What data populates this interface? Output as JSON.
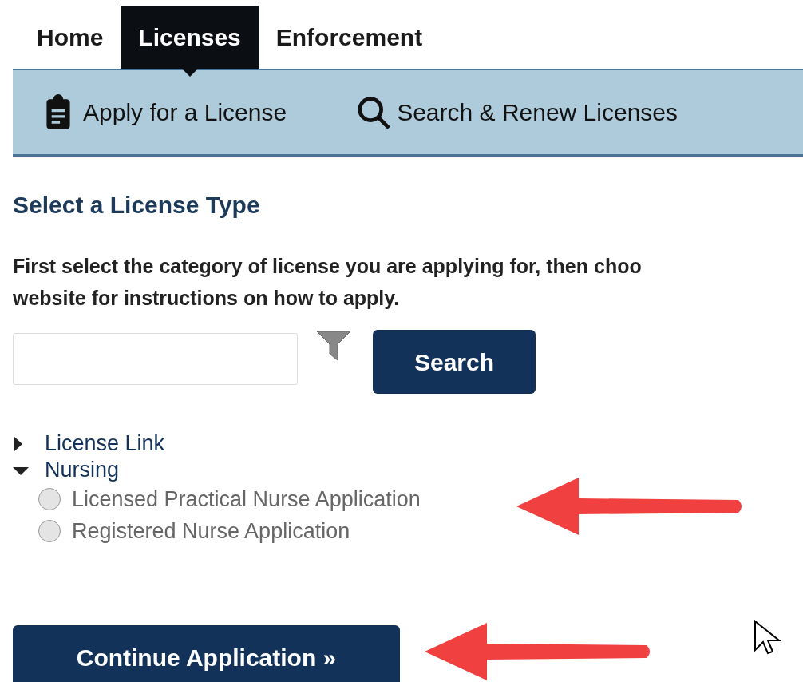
{
  "tabs": [
    {
      "label": "Home",
      "selected": false
    },
    {
      "label": "Licenses",
      "selected": true
    },
    {
      "label": "Enforcement",
      "selected": false
    }
  ],
  "subnav": [
    {
      "label": "Apply for a License",
      "kind": "clipboard"
    },
    {
      "label": "Search & Renew Licenses",
      "kind": "search"
    }
  ],
  "heading": "Select a License Type",
  "instructions": [
    "First select the category of license you are applying for, then choo",
    "website for instructions on how to apply."
  ],
  "search": {
    "button": "Search"
  },
  "tree": [
    {
      "label": "License Link",
      "expanded": false
    },
    {
      "label": "Nursing",
      "expanded": true,
      "children": [
        {
          "label": "Licensed Practical Nurse Application",
          "selected": false
        },
        {
          "label": "Registered Nurse Application",
          "selected": false
        }
      ]
    }
  ],
  "continue_button": "Continue Application »"
}
